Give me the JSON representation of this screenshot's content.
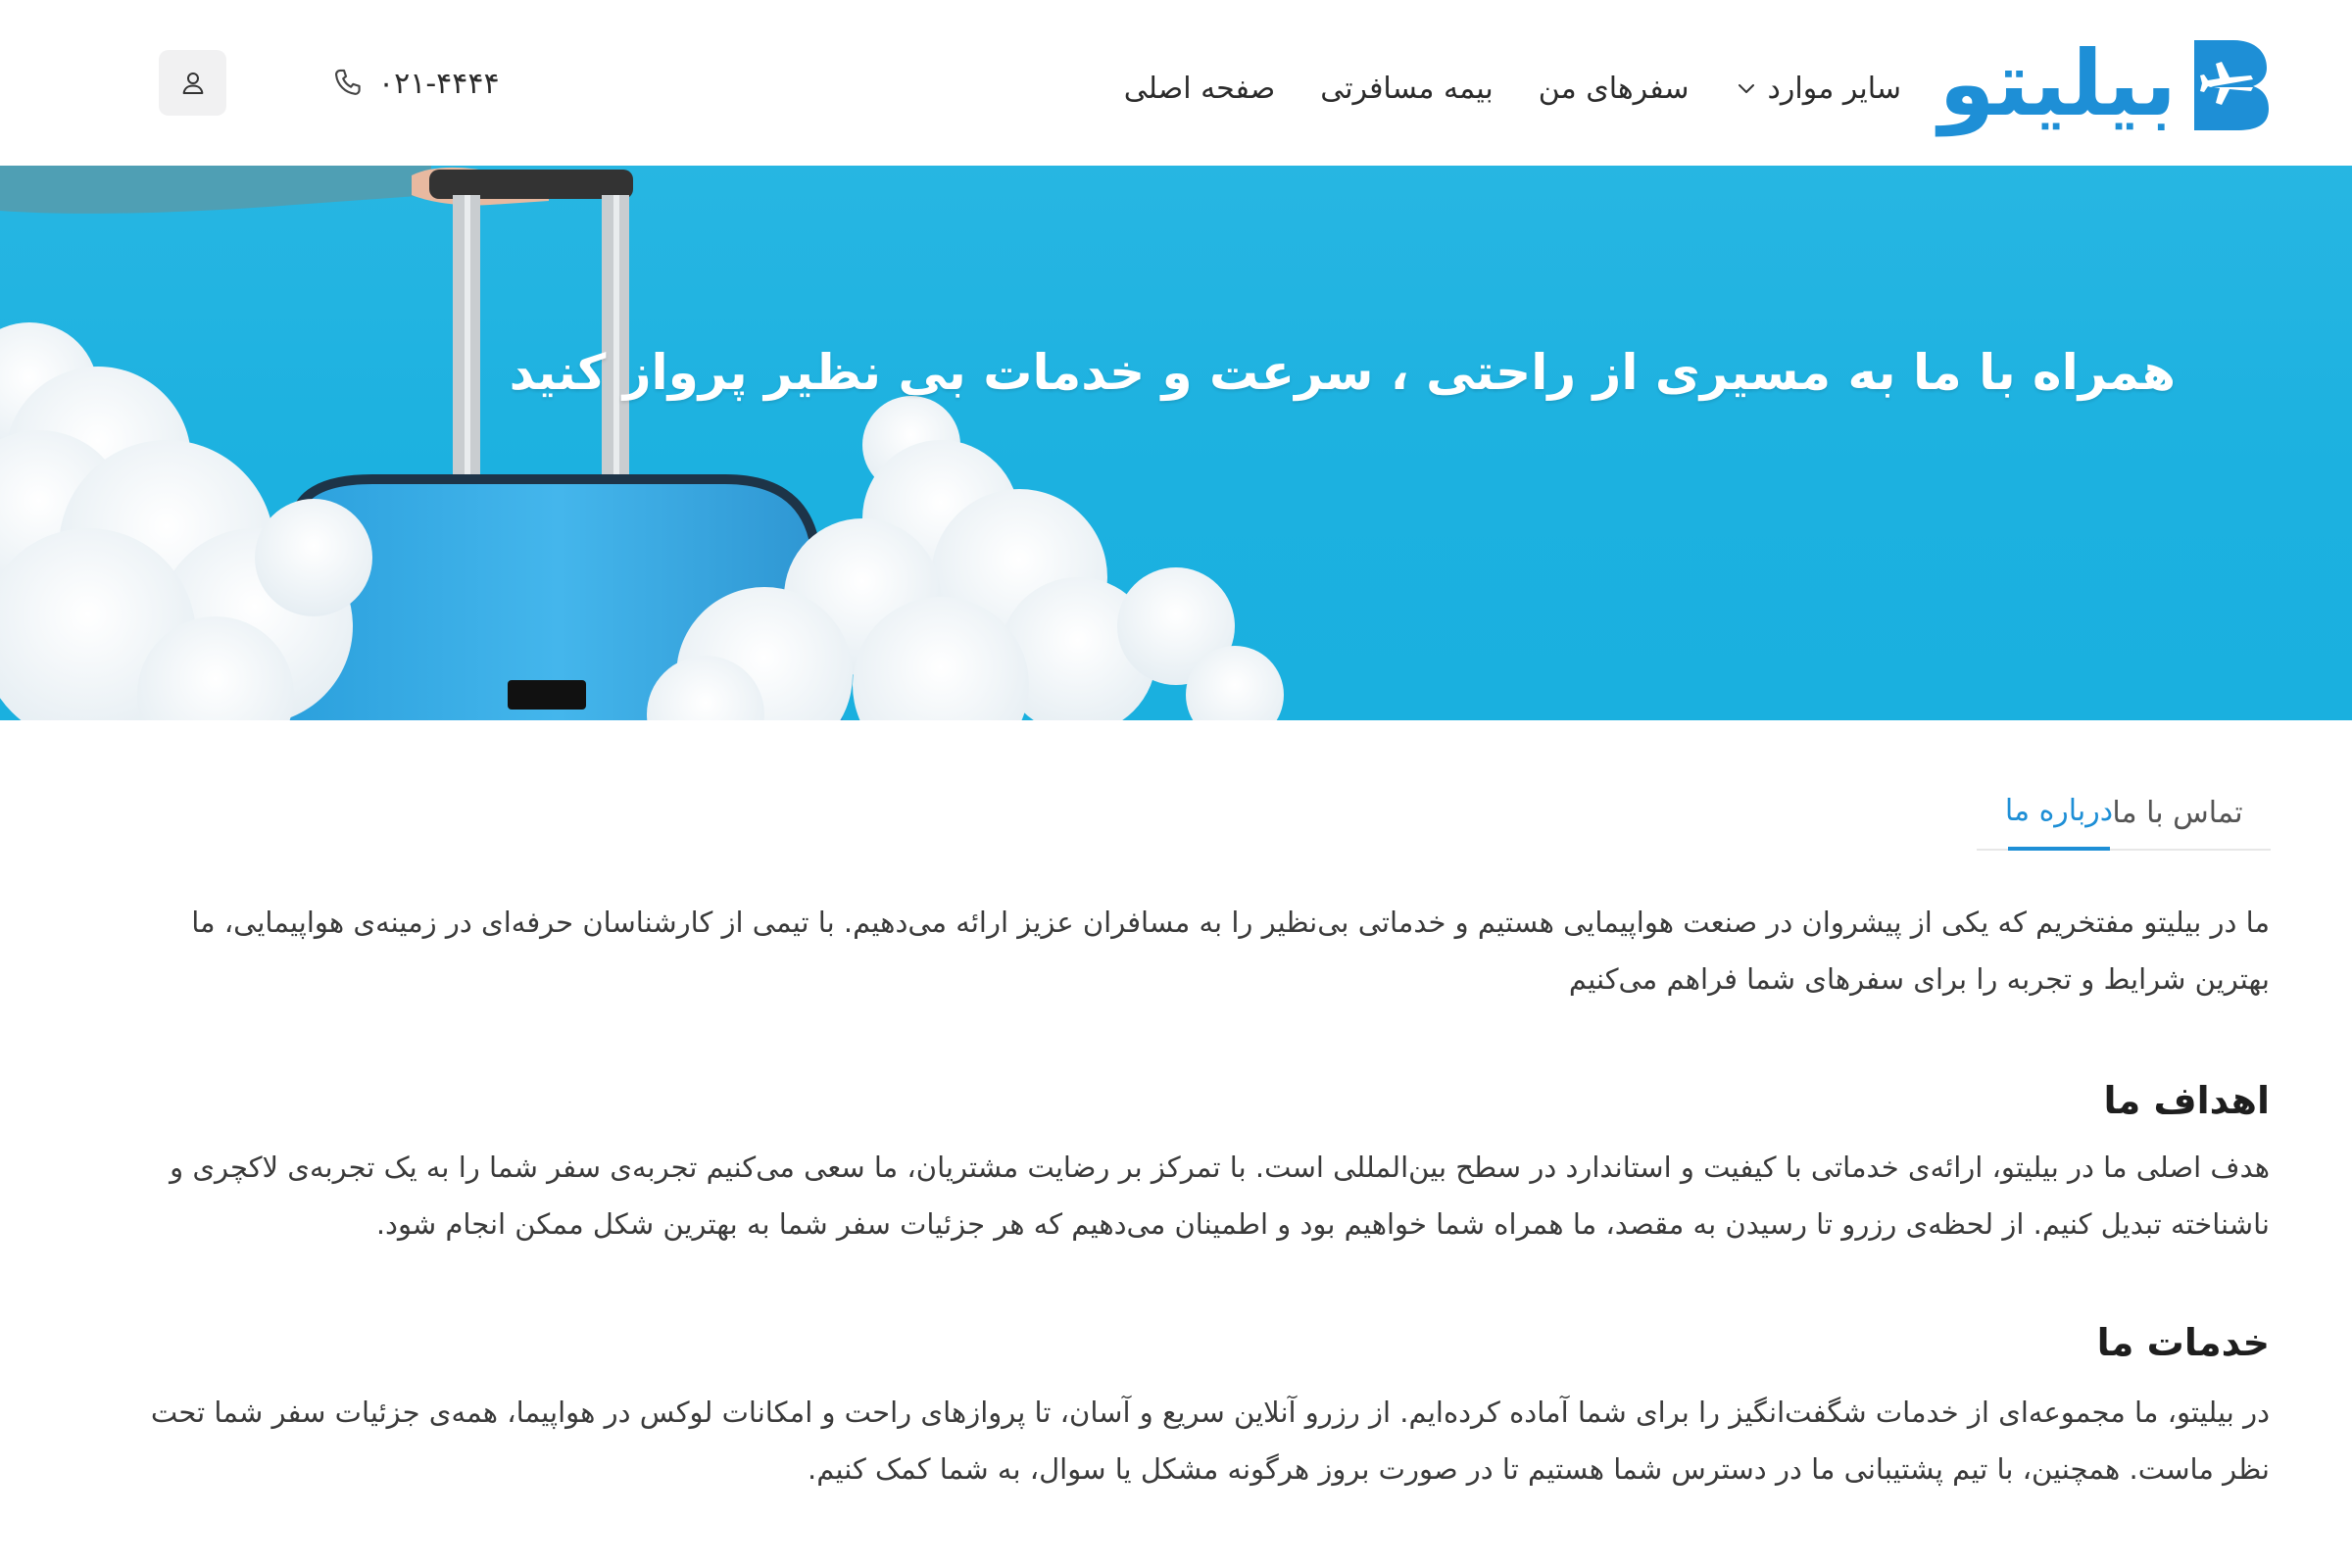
{
  "header": {
    "logo_text": "بیلیتو",
    "nav": [
      {
        "label": "صفحه اصلی"
      },
      {
        "label": "بیمه مسافرتی"
      },
      {
        "label": "سفرهای من"
      },
      {
        "label": "سایر موارد"
      }
    ],
    "phone": "۰۲۱-۴۴۴۴"
  },
  "hero": {
    "title": "همراه با ما به مسیری از راحتی ، سرعت و خدمات بی نظیر پرواز کنید"
  },
  "tabs": [
    {
      "label": "درباره ما",
      "active": true
    },
    {
      "label": "تماس با ما",
      "active": false
    }
  ],
  "about": {
    "intro": "ما در بیلیتو مفتخریم که یکی از پیشروان در صنعت هواپیمایی هستیم و خدماتی بی‌نظیر را به مسافران عزیز ارائه می‌دهیم. با تیمی از کارشناسان حرفه‌ای در زمینه‌ی هواپیمایی، ما بهترین شرایط و تجربه را برای سفرهای شما فراهم می‌کنیم",
    "goals_title": "اهداف ما",
    "goals_text": "هدف اصلی ما در بیلیتو، ارائه‌ی خدماتی با کیفیت و استاندارد در سطح بین‌المللی است. با تمرکز بر رضایت مشتریان، ما سعی می‌کنیم تجربه‌ی سفر شما را به یک تجربه‌ی لاکچری و ناشناخته تبدیل کنیم. از لحظه‌ی رزرو تا رسیدن به مقصد، ما همراه شما خواهیم بود و اطمینان می‌دهیم که هر جزئیات سفر شما به بهترین شکل ممکن انجام شود.",
    "services_title": "خدمات ما",
    "services_text": "در بیلیتو، ما مجموعه‌ای از خدمات شگفت‌انگیز را برای شما آماده کرده‌ایم. از رزرو آنلاین سریع و آسان، تا پروازهای راحت و امکانات لوکس در هواپیما، همه‌ی جزئیات سفر شما تحت نظر ماست. همچنین، با تیم پشتیبانی ما در دسترس شما هستیم تا در صورت بروز هرگونه مشکل یا سوال، به شما کمک کنیم."
  },
  "colors": {
    "brand": "#1e8fd6",
    "hero_bg": "#1cb1e0",
    "text": "#3a3a3a",
    "heading": "#1e1e1e"
  },
  "icons": {
    "logo_mark": "plane-b-logo-icon",
    "phone": "phone-icon",
    "user": "user-icon",
    "dropdown": "chevron-down-icon"
  }
}
